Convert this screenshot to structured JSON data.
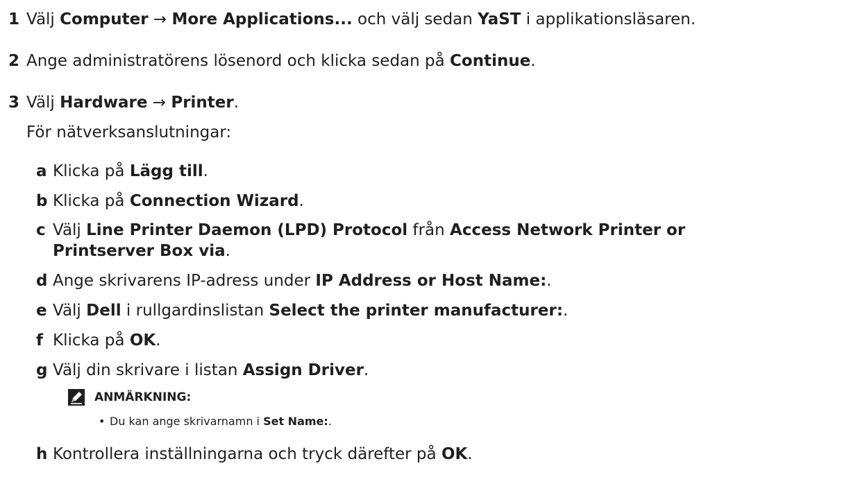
{
  "steps": [
    {
      "num": "1",
      "parts": [
        "Välj ",
        "Computer",
        " → ",
        "More Applications...",
        " och välj sedan ",
        "YaST",
        " i applikationsläsaren."
      ]
    },
    {
      "num": "2",
      "parts": [
        "Ange administratörens lösenord och klicka sedan på ",
        "Continue",
        "."
      ]
    },
    {
      "num": "3",
      "parts": [
        "Välj ",
        "Hardware",
        " → ",
        "Printer",
        "."
      ]
    }
  ],
  "network_intro": "För nätverksanslutningar:",
  "substeps": [
    {
      "letter": "a",
      "parts": [
        "Klicka på ",
        "Lägg till",
        "."
      ]
    },
    {
      "letter": "b",
      "parts": [
        "Klicka på ",
        "Connection Wizard",
        "."
      ]
    },
    {
      "letter": "c",
      "parts": [
        "Välj ",
        "Line Printer Daemon (LPD) Protocol",
        " från ",
        "Access Network Printer or"
      ],
      "cont": [
        "Printserver Box via",
        "."
      ]
    },
    {
      "letter": "d",
      "parts": [
        "Ange skrivarens IP-adress under ",
        "IP Address or Host Name:",
        "."
      ]
    },
    {
      "letter": "e",
      "parts": [
        "Välj ",
        "Dell",
        " i rullgardinslistan ",
        "Select the printer manufacturer:",
        "."
      ]
    },
    {
      "letter": "f",
      "parts": [
        "Klicka på ",
        "OK",
        "."
      ]
    },
    {
      "letter": "g",
      "parts": [
        "Välj din skrivare i listan ",
        "Assign Driver",
        "."
      ]
    },
    {
      "letter": "h",
      "parts": [
        "Kontrollera inställningarna och tryck därefter på ",
        "OK",
        "."
      ]
    }
  ],
  "note": {
    "icon": "pencil-note-icon",
    "title": "ANMÄRKNING:",
    "bullet": "•",
    "bullet_parts": [
      "Du kan ange skrivarnamn i ",
      "Set Name:",
      "."
    ]
  }
}
